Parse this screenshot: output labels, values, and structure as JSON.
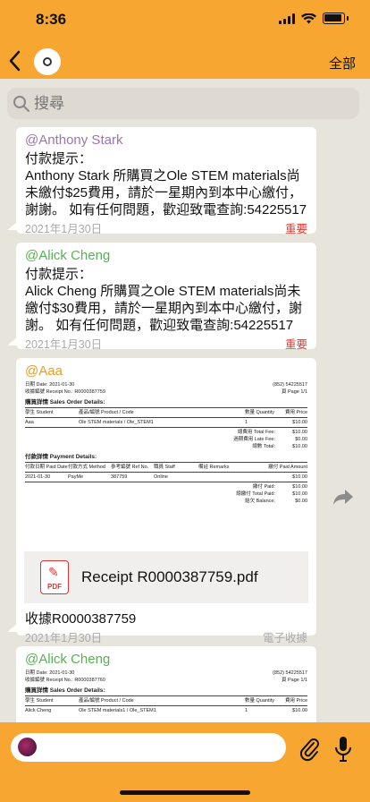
{
  "status_bar": {
    "time": "8:36"
  },
  "nav": {
    "all_label": "全部"
  },
  "search": {
    "placeholder": "搜尋"
  },
  "messages": [
    {
      "sender": "@Anthony Stark",
      "title": "付款提示：",
      "body": "Anthony Stark 所購買之Ole STEM materials尚未繳付$25費用，請於一星期內到本中心繳付，謝謝。 如有任何問題，歡迎致電查詢:54225517",
      "date": "2021年1月30日",
      "tag": "重要"
    },
    {
      "sender": "@Alick Cheng",
      "title": "付款提示：",
      "body": "Alick Cheng 所購買之Ole STEM materials尚未繳付$30費用，請於一星期內到本中心繳付，謝謝。 如有任何問題，歡迎致電查詢:54225517",
      "date": "2021年1月30日",
      "tag": "重要"
    },
    {
      "sender": "@Aaa",
      "receipt": {
        "date_line": "日期 Date:   2021-01-30",
        "receipt_no_line": "收據編號 Receipt No.: R0000387759",
        "phone": "(852) 54225517",
        "page": "頁 Page 1/1",
        "sales_title": "購買詳情 Sales Order Details:",
        "sales_headers": [
          "學生 Student",
          "產品/編號 Product / Code",
          "數量 Quantity",
          "費用 Price"
        ],
        "sales_row": [
          "Aaa",
          "Ole STEM materials / Ole_STEM1",
          "1",
          "$10.00"
        ],
        "total_fee": [
          "總費用 Total Fee:",
          "$10.00"
        ],
        "late_fee": [
          "過期費用 Late Fee:",
          "$0.00"
        ],
        "total": [
          "總數 Total:",
          "$10.00"
        ],
        "payment_title": "付款詳情 Payment Details:",
        "payment_headers": [
          "付款日期 Paid Date",
          "付款方式 Method",
          "參考編號 Ref No.",
          "職員 Staff",
          "備註 Remarks",
          "繳付 Paid Amount"
        ],
        "payment_row": [
          "2021-01-30",
          "PayMe",
          "387759",
          "Online",
          "",
          "$10.00"
        ],
        "total_paid": [
          "繳付 Paid:",
          "$10.00"
        ],
        "total_total_paid": [
          "總繳付 Total Paid:",
          "$10.00"
        ],
        "balance": [
          "結欠 Balance:",
          "$0.00"
        ]
      },
      "file_name": "Receipt R0000387759.pdf",
      "caption": "收據R0000387759",
      "date": "2021年1月30日",
      "tag": "電子收據"
    },
    {
      "sender": "@Alick Cheng",
      "receipt": {
        "date_line": "日期 Date:   2021-01-30",
        "receipt_no_line": "收據編號 Receipt No.: R0000387760",
        "phone": "(852) 54225517",
        "page": "頁 Page 1/1",
        "sales_title": "購買詳情 Sales Order Details:",
        "sales_headers": [
          "學生 Student",
          "產品/編號 Product / Code",
          "數量 Quantity",
          "費用 Price"
        ],
        "sales_row": [
          "Alick Cheng",
          "Ole STEM materials1 / Ole_STEM1",
          "1",
          "$10.00"
        ]
      }
    }
  ],
  "composer": {},
  "colors": {
    "accent": "#f7a632",
    "important": "#e23b30"
  }
}
